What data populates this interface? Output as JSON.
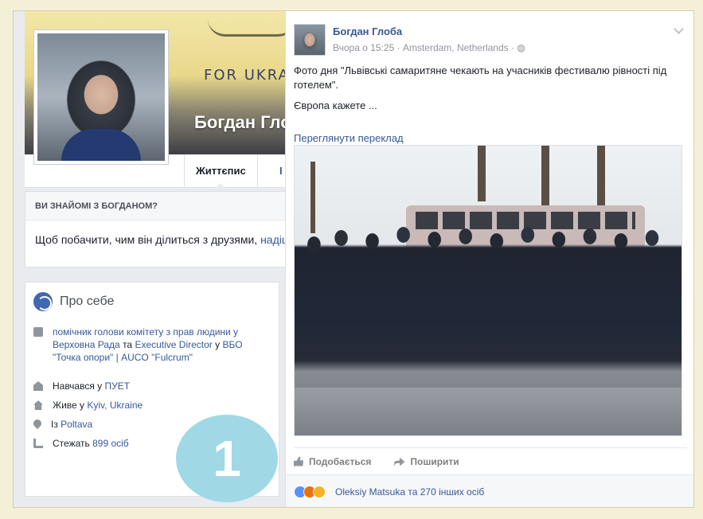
{
  "profile": {
    "cover_text": "FOR UKRA",
    "name": "Богдан Глоба",
    "tabs": [
      "Життєпис",
      "І"
    ],
    "know_heading": "ВИ ЗНАЙОМІ З БОГДАНОМ?",
    "know_text": "Щоб побачити, чим він ділиться з друзями, ",
    "know_link": "надішл"
  },
  "about": {
    "title": "Про себе",
    "rows": [
      {
        "icon": "briefcase-icon",
        "parts": [
          "помічник голови комітету з прав людини у Верховна Рада",
          " та ",
          "Executive Director",
          " у ",
          "ВБО \"Точка опори\" | AUCO \"Fulcrum\""
        ]
      },
      {
        "icon": "school-icon",
        "parts": [
          "Навчався у ",
          "ПУЕТ"
        ]
      },
      {
        "icon": "home-icon",
        "parts": [
          "Живе у ",
          "Kyiv, Ukraine"
        ]
      },
      {
        "icon": "map-pin-icon",
        "parts": [
          "Із ",
          "Poltava"
        ]
      },
      {
        "icon": "rss-icon",
        "parts": [
          "Стежать ",
          "899 осіб"
        ]
      }
    ]
  },
  "badge_number": "1",
  "post": {
    "author": "Богдан Глоба",
    "time": "Вчора о 15:25",
    "location": "Amsterdam, Netherlands",
    "text_line1": "Фото дня \"Львівські самаритяне чекають на учасників фестивалю рівності під готелем\".",
    "text_line2": "Європа кажете ...",
    "translate": "Переглянути переклад",
    "like_label": "Подобається",
    "share_label": "Поширити",
    "reactions_text": "Oleksiy Matsuka та 270 інших осіб"
  },
  "colors": {
    "link": "#365899",
    "background": "#f4f0d8",
    "badge": "#a0d8e6"
  }
}
